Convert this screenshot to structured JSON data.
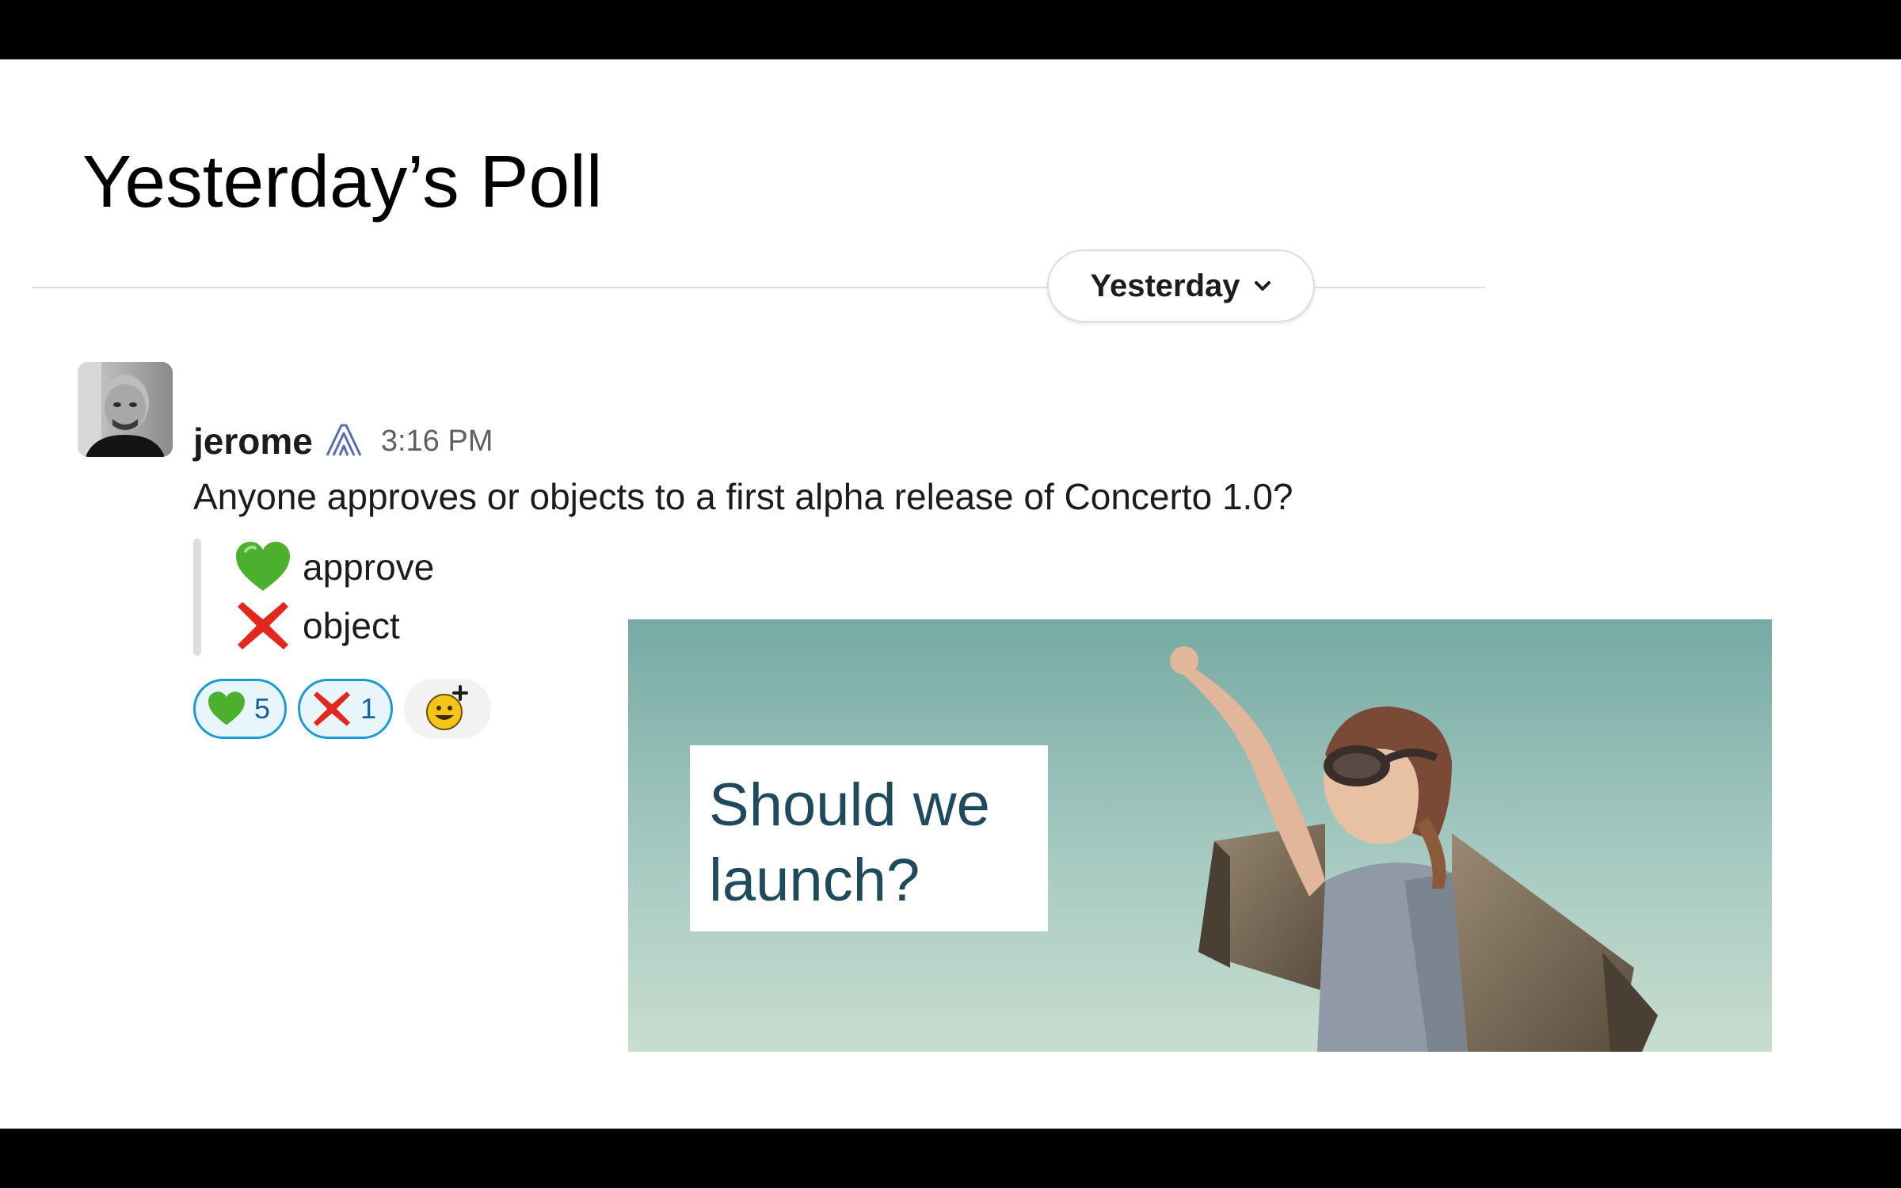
{
  "slide": {
    "title": "Yesterday’s Poll"
  },
  "date_divider": {
    "label": "Yesterday"
  },
  "message": {
    "author": "jerome",
    "timestamp": "3:16 PM",
    "text": "Anyone approves or objects to a first alpha release of Concerto 1.0?",
    "poll_options": [
      {
        "emoji": "green-heart",
        "label": "approve"
      },
      {
        "emoji": "cross-mark",
        "label": "object"
      }
    ],
    "reactions": [
      {
        "emoji": "green-heart",
        "count": "5"
      },
      {
        "emoji": "cross-mark",
        "count": "1"
      }
    ]
  },
  "image": {
    "caption": "Should we launch?"
  },
  "colors": {
    "reaction_border": "#1d9bd1",
    "reaction_bg": "#e8f5fa",
    "reaction_count": "#1264a3",
    "caption": "#1e4a5c",
    "heart": "#4caf2e",
    "cross": "#e0281e"
  }
}
